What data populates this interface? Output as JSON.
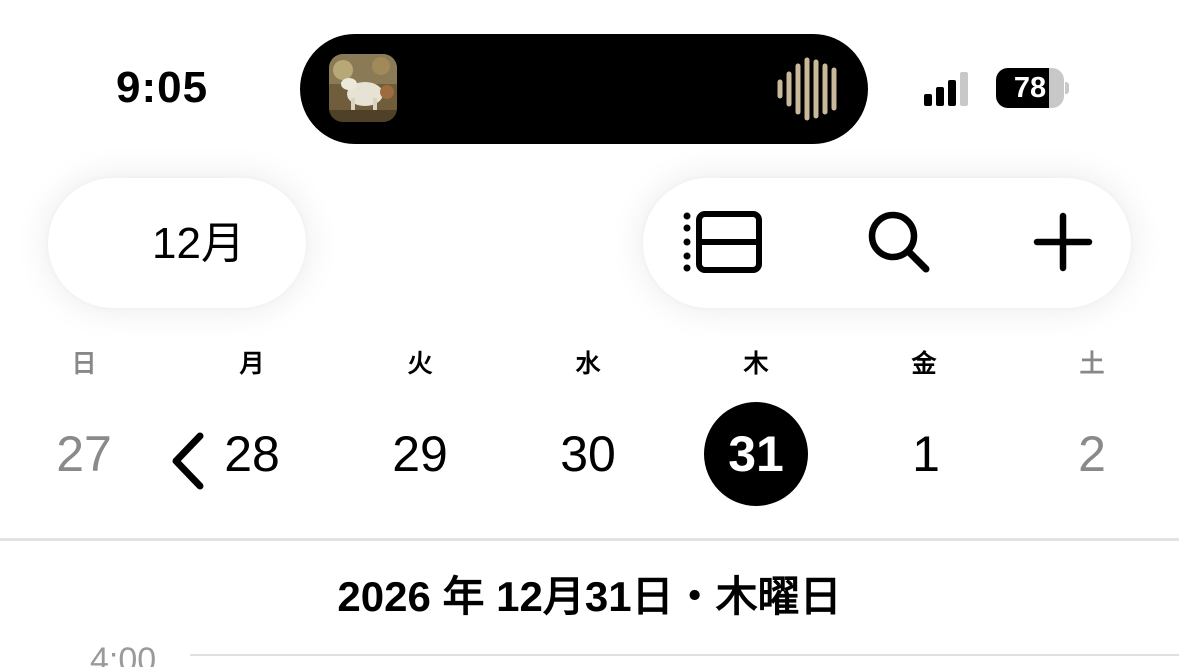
{
  "status_bar": {
    "time": "9:05",
    "battery_percent": "78",
    "battery_level": 0.78,
    "signal_bars_active": 3,
    "now_playing_icon": "album-artwork",
    "audio_indicator_icon": "waveform-icon"
  },
  "header": {
    "back_label": "12月",
    "back_icon": "chevron-left-icon",
    "tools": [
      "list-view-icon",
      "search-icon",
      "plus-icon"
    ]
  },
  "week": {
    "labels": [
      "日",
      "月",
      "火",
      "水",
      "木",
      "金",
      "土"
    ],
    "days": [
      "27",
      "28",
      "29",
      "30",
      "31",
      "1",
      "2"
    ],
    "today_index": 4
  },
  "date_heading": "2026 年 12月31日・木曜日",
  "timeline": {
    "first_hour_label": "4:00"
  },
  "colors": {
    "accent": "#000000",
    "muted_text": "#8a8a8a",
    "separator": "#e3e3e3"
  }
}
